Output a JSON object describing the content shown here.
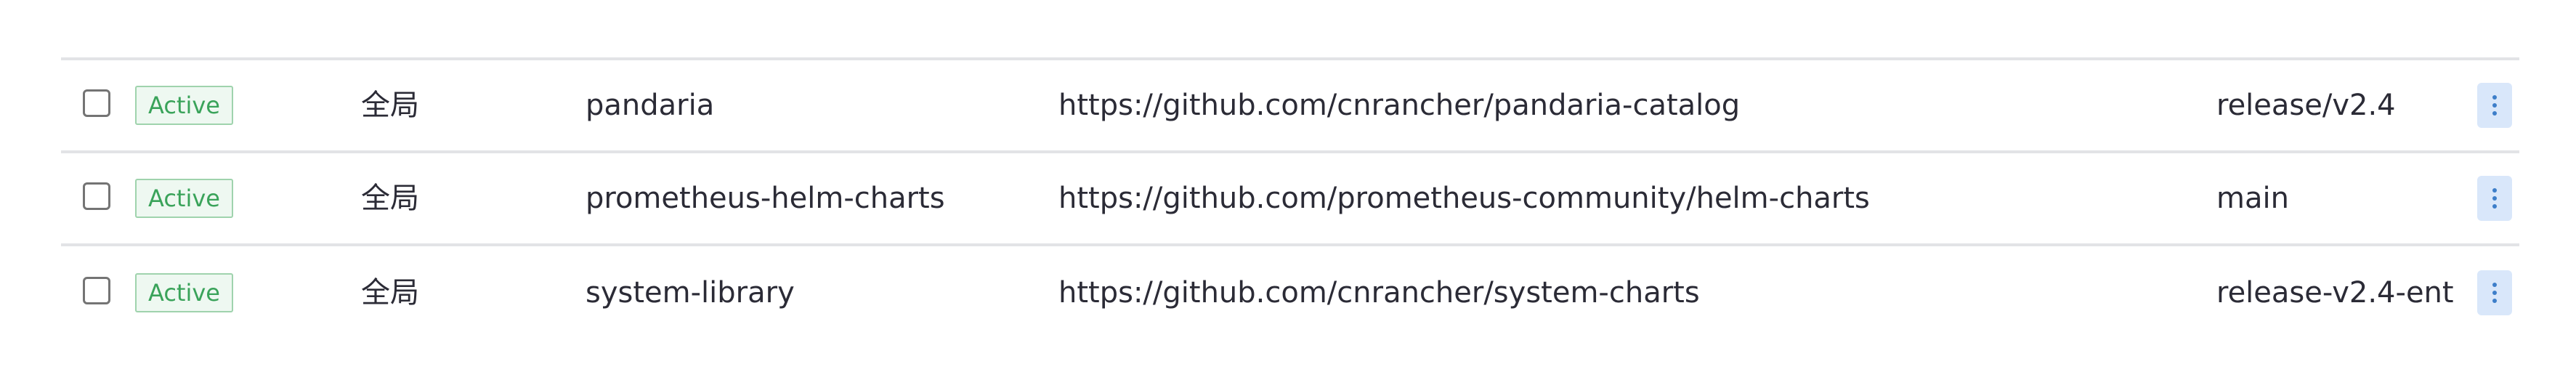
{
  "catalogs": {
    "rows": [
      {
        "state": "Active",
        "scope": "全局",
        "name": "pandaria",
        "url": "https://github.com/cnrancher/pandaria-catalog",
        "branch": "release/v2.4"
      },
      {
        "state": "Active",
        "scope": "全局",
        "name": "prometheus-helm-charts",
        "url": "https://github.com/prometheus-community/helm-charts",
        "branch": "main"
      },
      {
        "state": "Active",
        "scope": "全局",
        "name": "system-library",
        "url": "https://github.com/cnrancher/system-charts",
        "branch": "release-v2.4-ent"
      }
    ]
  },
  "icons": {
    "row_checkbox": "checkbox-icon",
    "row_actions": "kebab-menu-icon"
  },
  "colors": {
    "state_active_text": "#3aa35a",
    "state_active_bg": "#eef8f1",
    "state_active_border": "#9fd3ad",
    "action_button_bg": "#d9e7fa",
    "action_icon": "#3d7ec9",
    "row_divider": "#e2e3e6"
  }
}
